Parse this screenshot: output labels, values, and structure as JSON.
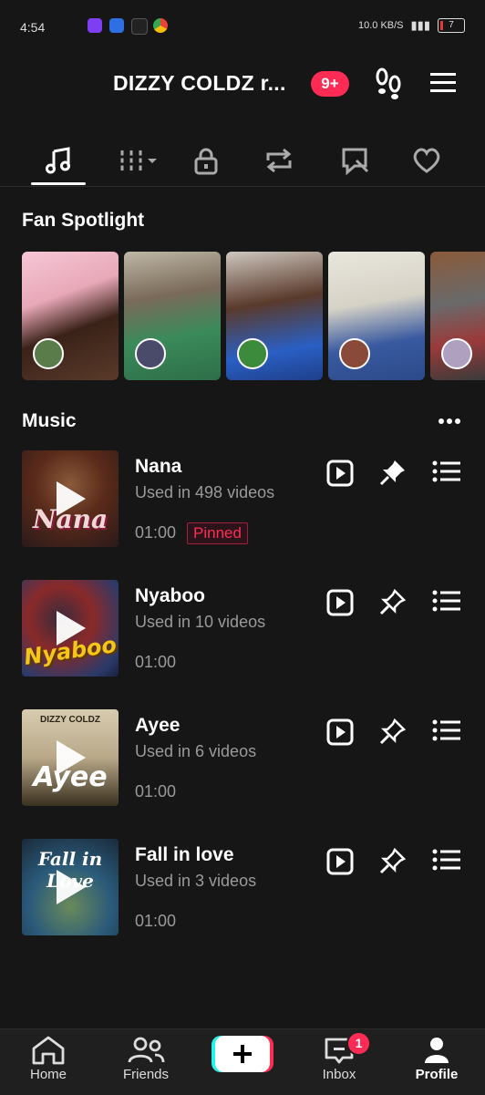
{
  "status_bar": {
    "time": "4:54",
    "network": "10.0 KB/S",
    "battery": "7"
  },
  "header": {
    "username": "DIZZY COLDZ r...",
    "notification_badge": "9+"
  },
  "tabs": [
    "music-note-icon",
    "grid-dropdown-icon",
    "lock-icon",
    "repost-icon",
    "tagged-icon",
    "heart-icon"
  ],
  "spotlight": {
    "title": "Fan Spotlight"
  },
  "music": {
    "title": "Music",
    "songs": [
      {
        "title": "Nana",
        "used": "Used in 498 videos",
        "duration": "01:00",
        "pinned_label": "Pinned",
        "cover_text": "Nana"
      },
      {
        "title": "Nyaboo",
        "used": "Used in 10 videos",
        "duration": "01:00",
        "cover_text": "Nyaboo"
      },
      {
        "title": "Ayee",
        "used": "Used in 6 videos",
        "duration": "01:00",
        "cover_text": "Ayee",
        "cover_top_text": "DIZZY COLDZ"
      },
      {
        "title": "Fall in love",
        "used": "Used in 3 videos",
        "duration": "01:00",
        "cover_text": "Fall in Love"
      }
    ]
  },
  "nav": {
    "home": "Home",
    "friends": "Friends",
    "inbox": "Inbox",
    "inbox_badge": "1",
    "profile": "Profile"
  },
  "colors": {
    "accent": "#fe2c55",
    "cyan": "#25f4ee",
    "background": "#161616"
  }
}
